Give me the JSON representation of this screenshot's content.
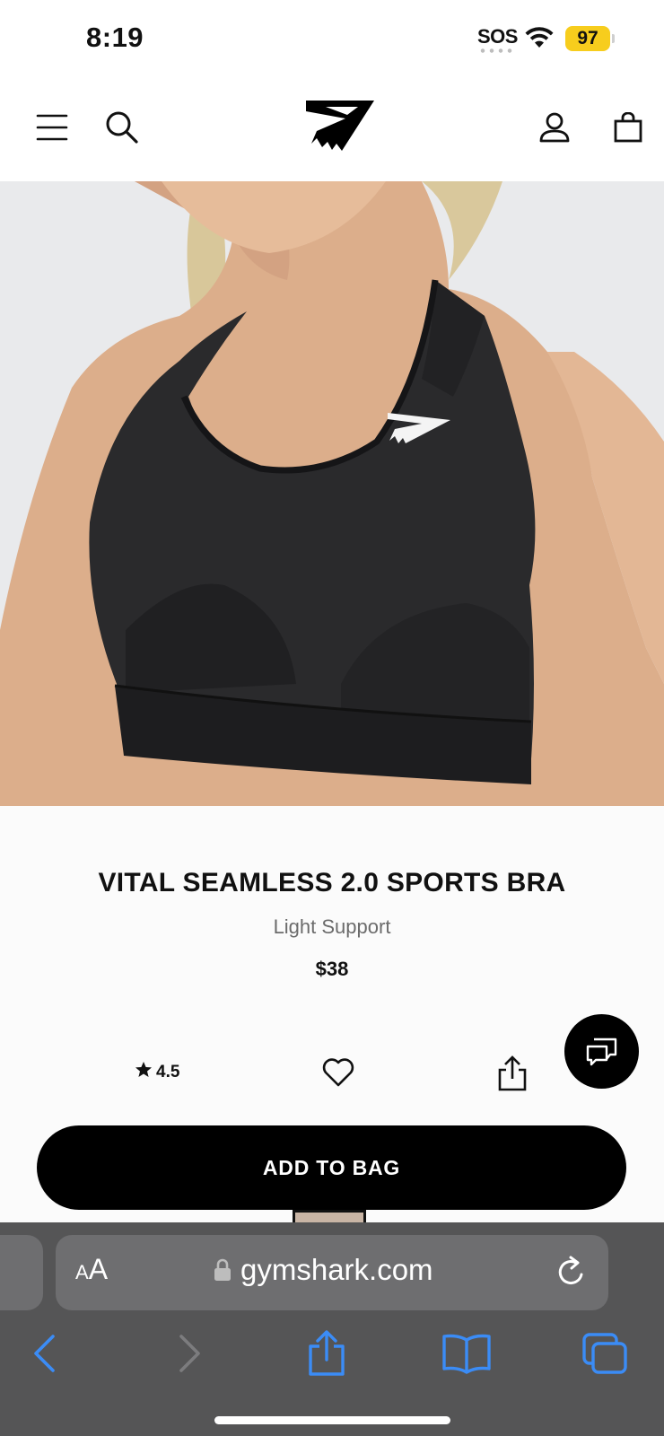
{
  "status_bar": {
    "time": "8:19",
    "sos": "SOS",
    "battery": "97"
  },
  "header": {
    "menu_icon": "hamburger-icon",
    "search_icon": "search-icon",
    "logo": "gymshark-logo",
    "account_icon": "user-icon",
    "bag_icon": "shopping-bag-icon"
  },
  "product": {
    "title": "VITAL SEAMLESS 2.0 SPORTS BRA",
    "subtitle": "Light Support",
    "price": "$38",
    "rating": "4.5",
    "add_to_bag_label": "ADD TO BAG"
  },
  "browser": {
    "aa_small": "A",
    "aa_large": "A",
    "url": "gymshark.com",
    "back_icon": "back-arrow-icon",
    "forward_icon": "forward-arrow-icon",
    "share_icon": "share-icon",
    "bookmarks_icon": "book-icon",
    "tabs_icon": "tabs-icon"
  },
  "colors": {
    "brand_black": "#000000",
    "battery_yellow": "#f7cd1d",
    "safari_blue": "#3b8cf6",
    "toolbar_gray": "#555556"
  }
}
